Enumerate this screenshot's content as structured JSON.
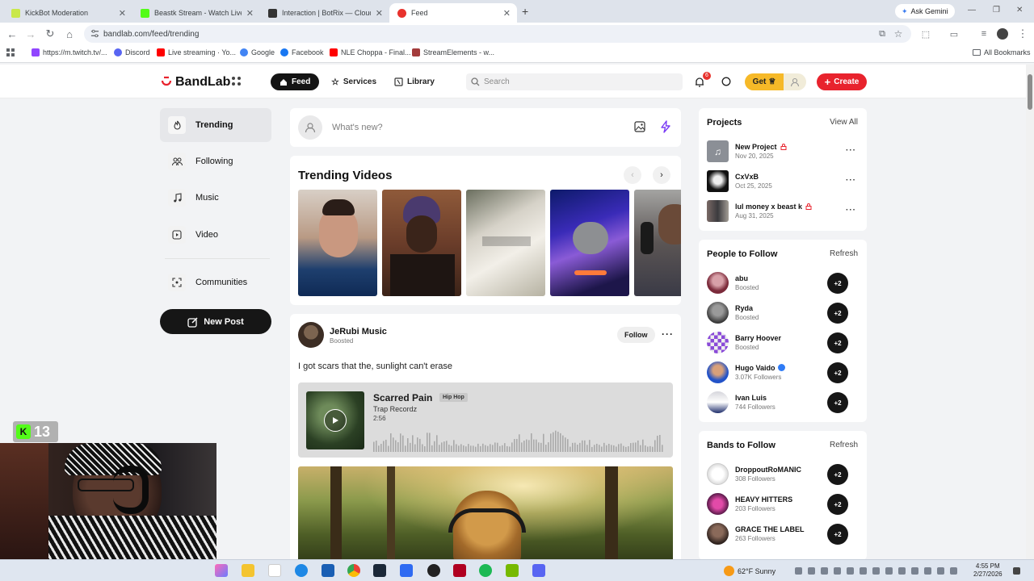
{
  "browser": {
    "tabs": [
      {
        "title": "KickBot Moderation",
        "color": "#c9e84a"
      },
      {
        "title": "Beastk Stream - Watch Live on",
        "color": "#53fc18"
      },
      {
        "title": "Interaction | BotRix — Cloud St",
        "color": "#333333"
      },
      {
        "title": "Feed",
        "color": "#e8322d"
      }
    ],
    "ask_gemini": "Ask Gemini",
    "url": "bandlab.com/feed/trending",
    "bookmarks": [
      {
        "label": "https://m.twitch.tv/...",
        "color": "#9146ff"
      },
      {
        "label": "Discord",
        "color": "#5865f2"
      },
      {
        "label": "Live streaming · Yo...",
        "color": "#ff0000"
      },
      {
        "label": "Google",
        "color": "#4285f4"
      },
      {
        "label": "Facebook",
        "color": "#1877f2"
      },
      {
        "label": "NLE Choppa - Final...",
        "color": "#ff0000"
      },
      {
        "label": "StreamElements - w...",
        "color": "#a33b3b"
      }
    ],
    "all_bookmarks": "All Bookmarks"
  },
  "header": {
    "logo": "BandLab",
    "feed": "Feed",
    "services": "Services",
    "library": "Library",
    "search_placeholder": "Search",
    "notif_count": "6",
    "get": "Get",
    "create": "Create",
    "brand_color": "#e8232d"
  },
  "sidebar": {
    "items": [
      {
        "label": "Trending",
        "icon": "flame-icon"
      },
      {
        "label": "Following",
        "icon": "people-icon"
      },
      {
        "label": "Music",
        "icon": "music-note-icon"
      },
      {
        "label": "Video",
        "icon": "video-icon"
      },
      {
        "label": "Communities",
        "icon": "communities-icon"
      }
    ],
    "new_post": "New Post"
  },
  "compose": {
    "placeholder": "What's new?"
  },
  "trending_videos": {
    "title": "Trending Videos"
  },
  "post": {
    "author": "JeRubi Music",
    "meta": "Boosted",
    "follow": "Follow",
    "text": "I got scars that the, sunlight can't erase",
    "track": {
      "title": "Scarred Pain",
      "genre": "Hip Hop",
      "artist": "Trap Recordz",
      "duration": "2:56"
    }
  },
  "projects": {
    "title": "Projects",
    "view_all": "View All",
    "items": [
      {
        "name": "New Project",
        "date": "Nov 20, 2025",
        "locked": true
      },
      {
        "name": "CxVxB",
        "date": "Oct 25, 2025",
        "locked": false
      },
      {
        "name": "lul money x beast k",
        "date": "Aug 31, 2025",
        "locked": true
      }
    ]
  },
  "people": {
    "title": "People to Follow",
    "refresh": "Refresh",
    "items": [
      {
        "name": "abu",
        "sub": "Boosted"
      },
      {
        "name": "Ryda",
        "sub": "Boosted"
      },
      {
        "name": "Barry Hoover",
        "sub": "Boosted"
      },
      {
        "name": "Hugo Vaido",
        "sub": "3.07K Followers",
        "verified": true
      },
      {
        "name": "Ivan Luis",
        "sub": "744 Followers"
      }
    ]
  },
  "bands": {
    "title": "Bands to Follow",
    "refresh": "Refresh",
    "items": [
      {
        "name": "DroppoutRoMANIC",
        "sub": "308 Followers"
      },
      {
        "name": "HEAVY HITTERS",
        "sub": "203 Followers"
      },
      {
        "name": "GRACE THE LABEL",
        "sub": "263 Followers"
      }
    ]
  },
  "follow_plus": "+2",
  "webcam": {
    "kick_count": "13"
  },
  "taskbar": {
    "weather": "62°F Sunny",
    "time": "4:55 PM",
    "date": "2/27/2026"
  }
}
